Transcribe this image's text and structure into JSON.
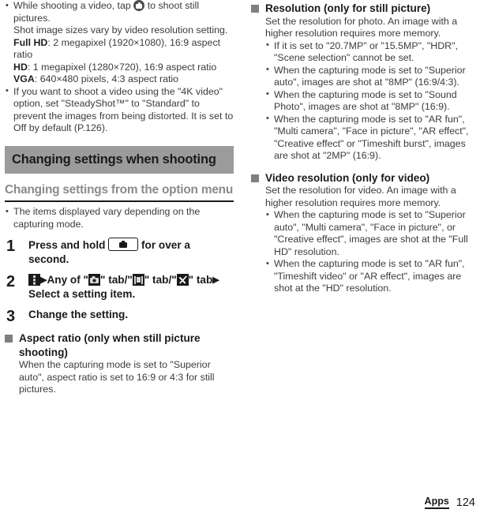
{
  "left_column": {
    "intro_bullets": [
      {
        "lead_before": "While shooting a video, tap",
        "icon": "shutter-round-icon",
        "lead_after": "to shoot still pictures.",
        "line2": "Shot image sizes vary by video resolution setting.",
        "specs": [
          {
            "label": "Full HD",
            "value": ": 2 megapixel (1920×1080), 16:9 aspect ratio"
          },
          {
            "label": "HD",
            "value": ": 1 megapixel (1280×720), 16:9 aspect ratio"
          },
          {
            "label": "VGA",
            "value": ": 640×480 pixels, 4:3 aspect ratio"
          }
        ]
      },
      {
        "text": "If you want to shoot a video using the \"4K video\" option, set \"SteadyShot™\" to \"Standard\" to prevent the images from being distorted. It is set to Off by default (P.126)."
      }
    ],
    "section_banner": "Changing settings when shooting",
    "sub_heading": "Changing settings from the option menu",
    "after_rule_bullets": [
      "The items displayed vary depending on the capturing mode."
    ],
    "steps": [
      {
        "number": "1",
        "text_before": "Press and hold",
        "icon": "camera-key-icon",
        "text_after": "for over a second."
      },
      {
        "number": "2",
        "icon1": "options-menu-icon",
        "arrow1": "▶",
        "text1": "Any of \"",
        "icon2": "camera-tab-icon",
        "text2": "\" tab/\"",
        "icon3": "video-tab-icon",
        "text3": "\" tab/",
        "text4": "\"",
        "icon4": "tools-tab-icon",
        "text5": "\" tab",
        "arrow2": "▶",
        "text6": "Select a setting item."
      },
      {
        "number": "3",
        "text": "Change the setting."
      }
    ],
    "aspect_ratio_block": {
      "heading": "Aspect ratio (only when still picture shooting)",
      "body": "When the capturing mode is set to \"Superior auto\", aspect ratio is set to 16:9 or 4:3 for still pictures."
    }
  },
  "right_column": {
    "resolution_block": {
      "heading": "Resolution (only for still picture)",
      "body": "Set the resolution for photo. An image with a higher resolution requires more memory.",
      "bullets": [
        "If it is set to \"20.7MP\" or \"15.5MP\", \"HDR\", \"Scene selection\" cannot be set.",
        "When the capturing mode is set to \"Superior auto\", images are shot at \"8MP\" (16:9/4:3).",
        "When the capturing mode is set to \"Sound Photo\", images are shot at \"8MP\" (16:9).",
        "When the capturing mode is set to \"AR fun\", \"Multi camera\", \"Face in picture\", \"AR effect\", \"Creative effect\" or \"Timeshift burst\", images are shot at \"2MP\" (16:9)."
      ]
    },
    "video_resolution_block": {
      "heading": "Video resolution (only for video)",
      "body": "Set the resolution for video. An image with a higher resolution requires more memory.",
      "bullets": [
        "When the capturing mode is set to \"Superior auto\", \"Multi camera\", \"Face in picture\", or \"Creative effect\", images are shot at the \"Full HD\" resolution.",
        "When the capturing mode is set to \"AR fun\", \"Timeshift video\" or \"AR effect\", images are shot at the \"HD\" resolution."
      ]
    }
  },
  "footer": {
    "tab_label": "Apps",
    "page_number": "124"
  },
  "colors": {
    "banner_bg": "#9b9b9b",
    "square_bullet": "#7f7f7f",
    "sub_heading": "#8a8a8a",
    "body_text": "#3b3b3b",
    "heading_text": "#1a1a1a"
  }
}
